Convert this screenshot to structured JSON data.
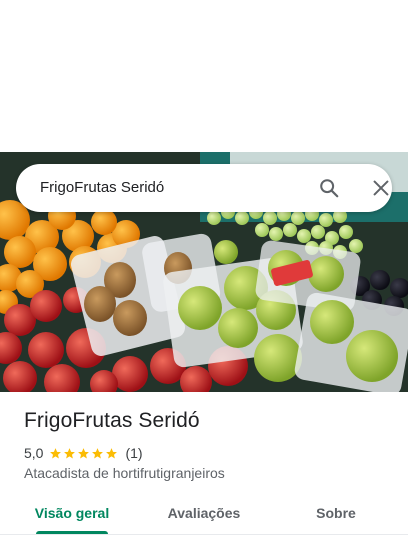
{
  "search": {
    "query": "FrigoFrutas Seridó",
    "search_icon": "search-icon",
    "close_icon": "close-icon"
  },
  "place": {
    "name": "FrigoFrutas Seridó",
    "rating": "5,0",
    "stars": 5,
    "review_count": "(1)",
    "category": "Atacadista de hortifrutigranjeiros"
  },
  "tabs": [
    {
      "label": "Visão geral",
      "active": true
    },
    {
      "label": "Avaliações",
      "active": false
    },
    {
      "label": "Sobre",
      "active": false
    }
  ],
  "colors": {
    "accent": "#01875f",
    "star": "#fbbc04",
    "text_primary": "#202124",
    "text_secondary": "#5f6368"
  }
}
